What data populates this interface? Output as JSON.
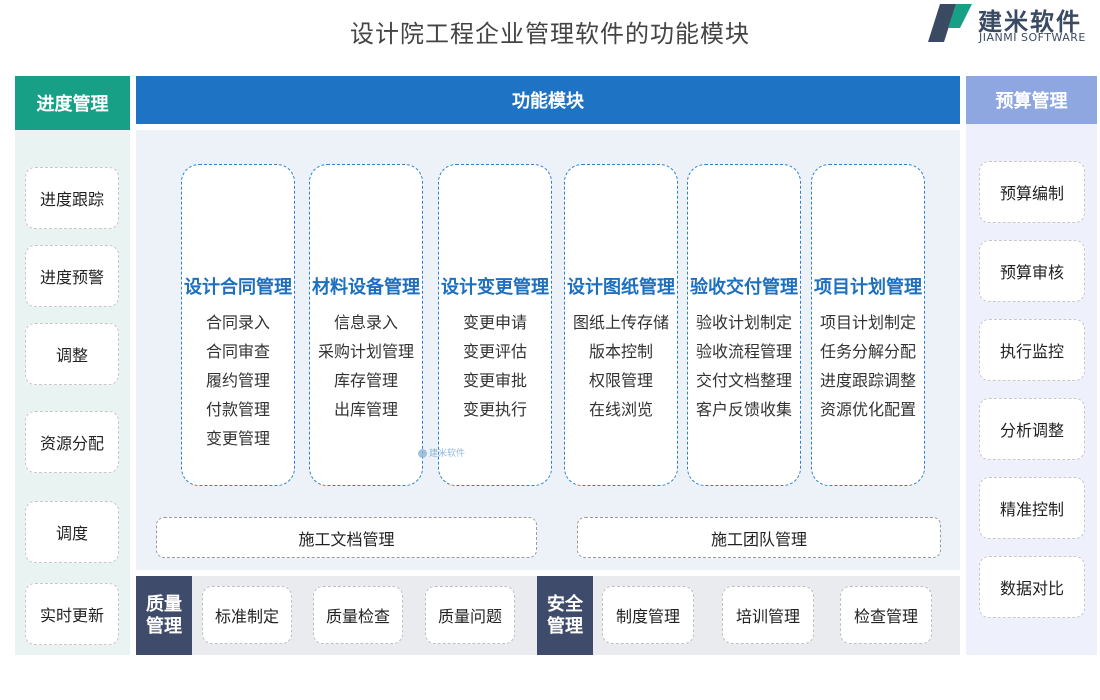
{
  "title": "设计院工程企业管理软件的功能模块",
  "logo": {
    "name_cn": "建米软件",
    "name_en": "JIANMI SOFTWARE"
  },
  "left": {
    "header": "进度管理",
    "items": [
      "进度跟踪",
      "进度预警",
      "调整",
      "资源分配",
      "调度",
      "实时更新"
    ]
  },
  "right": {
    "header": "预算管理",
    "items": [
      "预算编制",
      "预算审核",
      "执行监控",
      "分析调整",
      "精准控制",
      "数据对比"
    ]
  },
  "center": {
    "header": "功能模块",
    "modules": [
      {
        "title": "设计合同管理",
        "items": [
          "合同录入",
          "合同审查",
          "履约管理",
          "付款管理",
          "变更管理"
        ]
      },
      {
        "title": "材料设备管理",
        "items": [
          "信息录入",
          "采购计划管理",
          "库存管理",
          "出库管理"
        ]
      },
      {
        "title": "设计变更管理",
        "items": [
          "变更申请",
          "变更评估",
          "变更审批",
          "变更执行"
        ]
      },
      {
        "title": "设计图纸管理",
        "items": [
          "图纸上传存储",
          "版本控制",
          "权限管理",
          "在线浏览"
        ]
      },
      {
        "title": "验收交付管理",
        "items": [
          "验收计划制定",
          "验收流程管理",
          "交付文档整理",
          "客户反馈收集"
        ]
      },
      {
        "title": "项目计划管理",
        "items": [
          "项目计划制定",
          "任务分解分配",
          "进度跟踪调整",
          "资源优化配置"
        ]
      }
    ],
    "wide": [
      "施工文档管理",
      "施工团队管理"
    ],
    "watermark": "建米软件"
  },
  "bottom": {
    "quality": {
      "label": "质量管理",
      "items": [
        "标准制定",
        "质量检查",
        "质量问题"
      ]
    },
    "safety": {
      "label": "安全管理",
      "items": [
        "制度管理",
        "培训管理",
        "检查管理"
      ]
    }
  },
  "colors": {
    "progress_header": "#17a085",
    "function_header": "#1e73c4",
    "budget_header": "#8ea7e0",
    "module_title": "#1d6fc0",
    "bottom_tag": "#3f4b6a"
  }
}
